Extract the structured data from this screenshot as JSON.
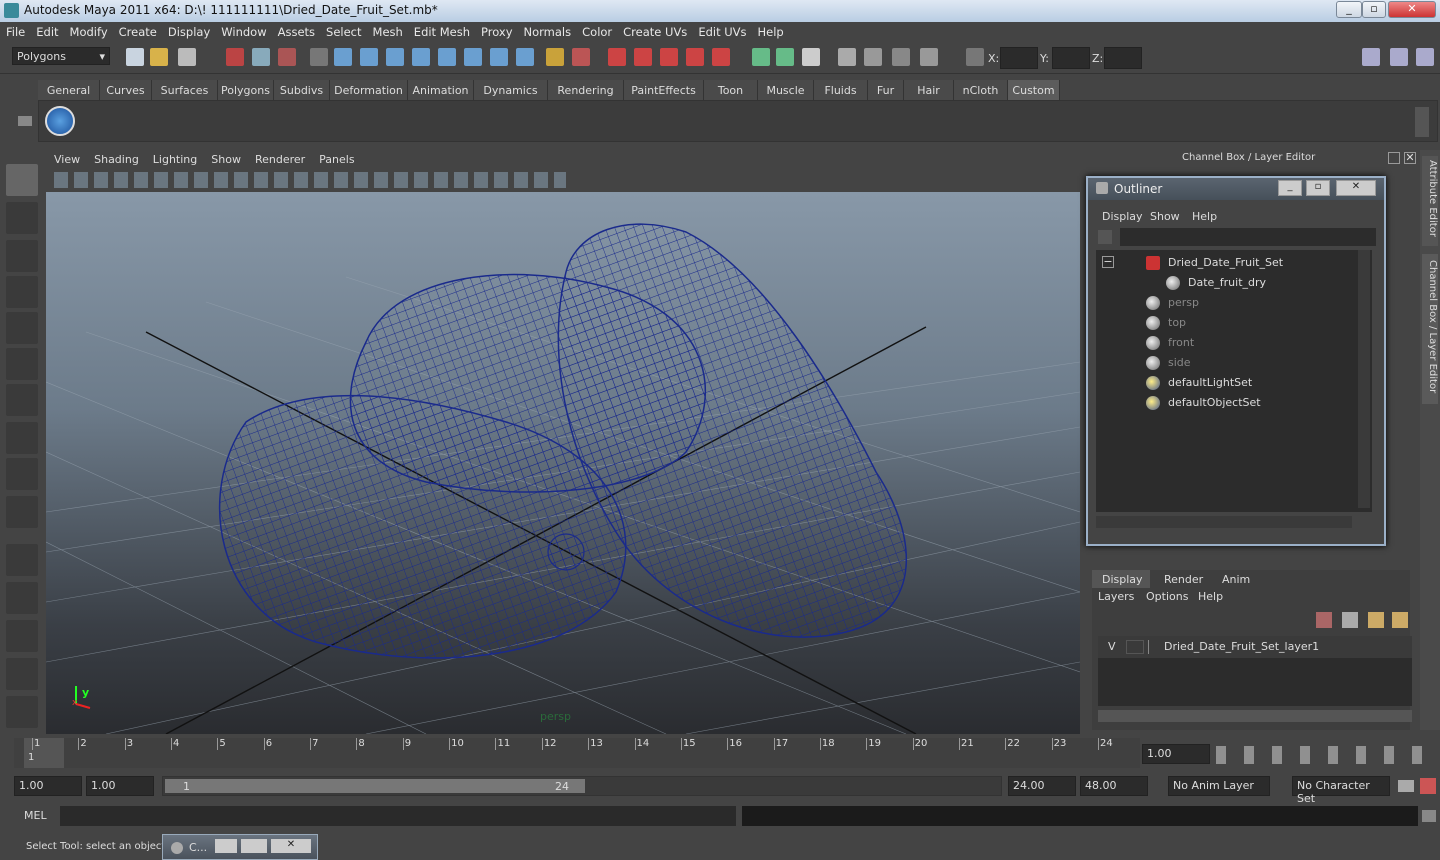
{
  "window": {
    "title": "Autodesk Maya 2011 x64: D:\\! 111111111\\Dried_Date_Fruit_Set.mb*",
    "min": "_",
    "max": "▫",
    "close": "✕"
  },
  "menu": [
    "File",
    "Edit",
    "Modify",
    "Create",
    "Display",
    "Window",
    "Assets",
    "Select",
    "Mesh",
    "Edit Mesh",
    "Proxy",
    "Normals",
    "Color",
    "Create UVs",
    "Edit UVs",
    "Help"
  ],
  "status": {
    "mode": "Polygons",
    "x_label": "X:",
    "y_label": "Y:",
    "z_label": "Z:"
  },
  "shelf_tabs": [
    "General",
    "Curves",
    "Surfaces",
    "Polygons",
    "Subdivs",
    "Deformation",
    "Animation",
    "Dynamics",
    "Rendering",
    "PaintEffects",
    "Toon",
    "Muscle",
    "Fluids",
    "Fur",
    "Hair",
    "nCloth",
    "Custom"
  ],
  "shelf_active": "Custom",
  "viewport": {
    "menu": [
      "View",
      "Shading",
      "Lighting",
      "Show",
      "Renderer",
      "Panels"
    ],
    "camera_label": "persp",
    "axis_y": "y",
    "axis_x": "x"
  },
  "channel_box_title": "Channel Box / Layer Editor",
  "outliner": {
    "title": "Outliner",
    "menu": [
      "Display",
      "Show",
      "Help"
    ],
    "items": [
      {
        "label": "Dried_Date_Fruit_Set",
        "dim": false
      },
      {
        "label": "Date_fruit_dry",
        "dim": false
      },
      {
        "label": "persp",
        "dim": true
      },
      {
        "label": "top",
        "dim": true
      },
      {
        "label": "front",
        "dim": true
      },
      {
        "label": "side",
        "dim": true
      },
      {
        "label": "defaultLightSet",
        "dim": false
      },
      {
        "label": "defaultObjectSet",
        "dim": false
      }
    ],
    "collapse": "−"
  },
  "layer_editor": {
    "tabs": [
      "Display",
      "Render",
      "Anim"
    ],
    "menu": [
      "Layers",
      "Options",
      "Help"
    ],
    "layer": {
      "v": "V",
      "name": "Dried_Date_Fruit_Set_layer1"
    }
  },
  "side_tabs": [
    "Attribute Editor",
    "Channel Box / Layer Editor"
  ],
  "timeline": {
    "ticks": [
      "1",
      "2",
      "3",
      "4",
      "5",
      "6",
      "7",
      "8",
      "9",
      "10",
      "11",
      "12",
      "13",
      "14",
      "15",
      "16",
      "17",
      "18",
      "19",
      "20",
      "21",
      "22",
      "23",
      "24"
    ],
    "current_frame": "1",
    "current_field": "1.00"
  },
  "range": {
    "start": "1.00",
    "start2": "1.00",
    "slider_start": "1",
    "slider_end": "24",
    "end": "24.00",
    "end2": "48.00",
    "anim_layer": "No Anim Layer",
    "char_set": "No Character Set"
  },
  "cmd": {
    "label": "MEL"
  },
  "help": {
    "text": "Select Tool: select an object",
    "task_label": "C..."
  }
}
